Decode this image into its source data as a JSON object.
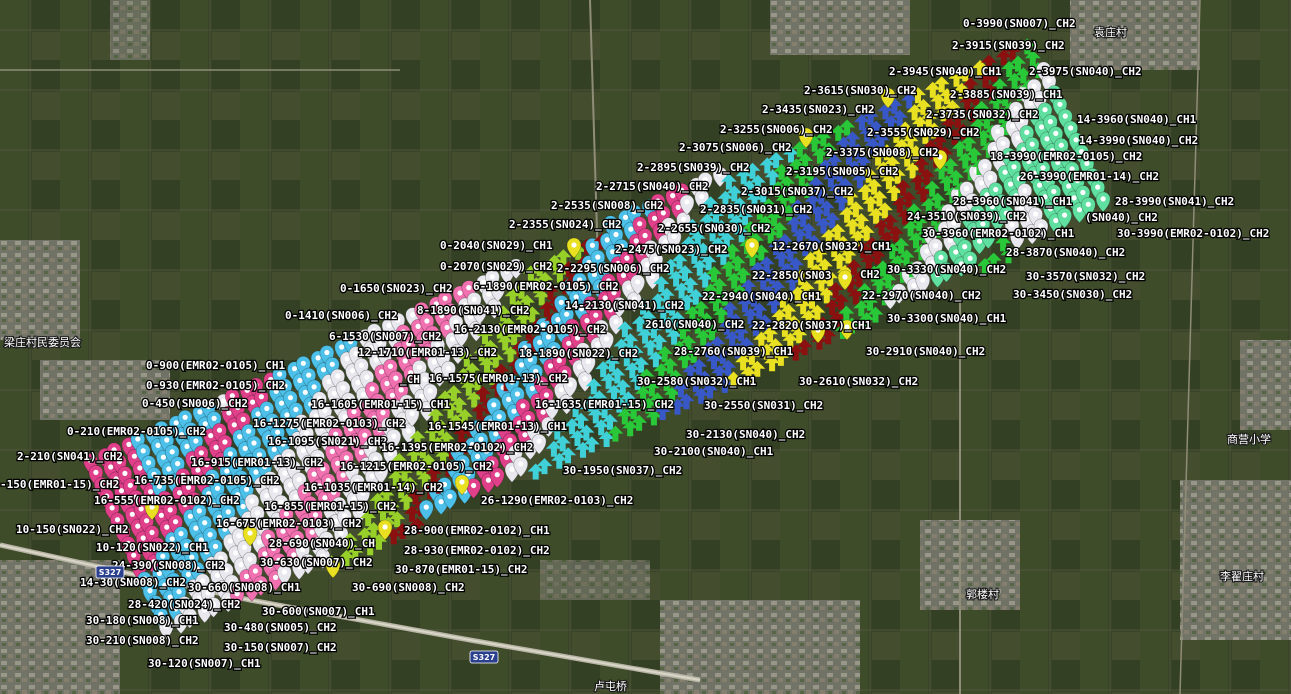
{
  "colors": {
    "magenta": "#e0408a",
    "white": "#e8e8ee",
    "skyblue": "#4cc0e8",
    "lime": "#98d02a",
    "darkred": "#8b1010",
    "yellow": "#e8e020",
    "blue": "#3858c8",
    "green": "#28c838",
    "cyan": "#40d0d8",
    "pink": "#f070b0",
    "mint": "#60e0a0"
  },
  "icons": {
    "pin": "map-pin-icon",
    "arrow": "arrow-marker-icon",
    "star": "star-pin-icon"
  },
  "places": [
    "梁庄村民委员会",
    "商营小学",
    "李翟庄村",
    "郭楼村",
    "袁庄村",
    "卢屯桥"
  ],
  "roads": [
    "S327",
    "S327"
  ],
  "labels": [
    "0-3990(SN007)_CH2",
    "2-3915(SN039)_CH2",
    "2-3945(SN040)_CH1",
    "2-3975(SN040)_CH2",
    "2-3615(SN030)_CH2",
    "2-3885(SN039)_CH1",
    "2-3435(SN023)_CH2",
    "2-3735(SN032)_CH2",
    "14-3960(SN040)_CH1",
    "2-3255(SN006)_CH2",
    "2-3555(SN029)_CH2",
    "14-3990(SN040)_CH2",
    "2-3075(SN006)_CH2",
    "2-3375(SN008)_CH2",
    "18-3990(EMR02-0105)_CH2",
    "2-2895(SN039)_CH2",
    "2-3195(SN005)_CH2",
    "26-3990(EMR01-14)_CH2",
    "2-2715(SN040)_CH2",
    "2-3015(SN037)_CH2",
    "2-2535(SN008)_CH2",
    "2-2835(SN031)_CH2",
    "28-3960(SN041)_CH1",
    "28-3990(SN041)_CH2",
    "2-2355(SN024)_CH2",
    "2-2655(SN030)_CH2",
    "24-3510(SN039)_CH2",
    "(SN040)_CH2",
    "30-3960(EMR02-0102)_CH1",
    "30-3990(EMR02-0102)_CH2",
    "0-2040(SN029)_CH1",
    "2-2475(SN023)_CH2",
    "12-2670(SN032)_CH1",
    "28-3870(SN040)_CH2",
    "0-2070(SN029)_CH2",
    "2-2295(SN006)_CH2",
    "22-2850(SN03",
    "CH2",
    "30-3330(SN040)_CH2",
    "30-3570(SN032)_CH2",
    "6-1890(EMR02-0105)_CH2",
    "0-1650(SN023)_CH2",
    "22-2940(SN040)_CH1",
    "22-2970(SN040)_CH2",
    "30-3450(SN030)_CH2",
    "14-2130(SN041)_CH2",
    "8-1890(SN041)_CH2",
    "0-1410(SN006)_CH2",
    "30-3300(SN040)_CH1",
    "2610(SN040)_CH2",
    "22-2820(SN037)_CH1",
    "16-2130(EMR02-0105)_CH2",
    "6-1530(SN007)_CH2",
    "28-2760(SN039)_CH1",
    "30-2910(SN040)_CH2",
    "12-1710(EMR01-13)_CH2",
    "18-1890(SN022)_CH2",
    "0-900(EMR02-0105)_CH1",
    "_CH",
    "16-1575(EMR01-13)_CH2",
    "30-2580(SN032)_CH1",
    "30-2610(SN032)_CH2",
    "0-930(EMR02-0105)_CH2",
    "0-450(SN006)_CH2",
    "16-1605(EMR01-15)_CH1",
    "16-1635(EMR01-15)_CH2",
    "30-2550(SN031)_CH2",
    "16-1275(EMR02-0103)_CH2",
    "16-1545(EMR01-13)_CH1",
    "0-210(EMR02-0105)_CH2",
    "16-1095(SN021)_CH2",
    "30-2130(SN040)_CH2",
    "16-1395(EMR02-0102)_CH2",
    "2-210(SN041)_CH2",
    "30-2100(SN040)_CH1",
    "16-915(EMR01-13)_CH2",
    "16-1215(EMR02-0105)_CH2",
    "30-1950(SN037)_CH2",
    "-150(EMR01-15)_CH2",
    "16-735(EMR02-0105)_CH2",
    "16-1035(EMR01-14)_CH2",
    "16-555(EMR02-0102)_CH2",
    "26-1290(EMR02-0103)_CH2",
    "16-855(EMR01-15)_CH2",
    "16-675(EMR02-0103)_CH2",
    "10-150(SN022)_CH2",
    "28-900(EMR02-0102)_CH1",
    "10-120(SN022)_CH1",
    "28-690(SN040)_CH",
    "28-930(EMR02-0102)_CH2",
    "24-390(SN008)_CH2",
    "30-630(SN007)_CH2",
    "30-870(EMR01-15)_CH2",
    "14-30(SN008)_CH2",
    "30-660(SN008)_CH1",
    "30-690(SN008)_CH2",
    "28-420(SN024)_CH2",
    "30-600(SN007)_CH1",
    "30-180(SN008)_CH1",
    "30-210(SN008)_CH2",
    "30-480(SN005)_CH2",
    "30-150(SN007)_CH2",
    "30-120(SN007)_CH1"
  ]
}
